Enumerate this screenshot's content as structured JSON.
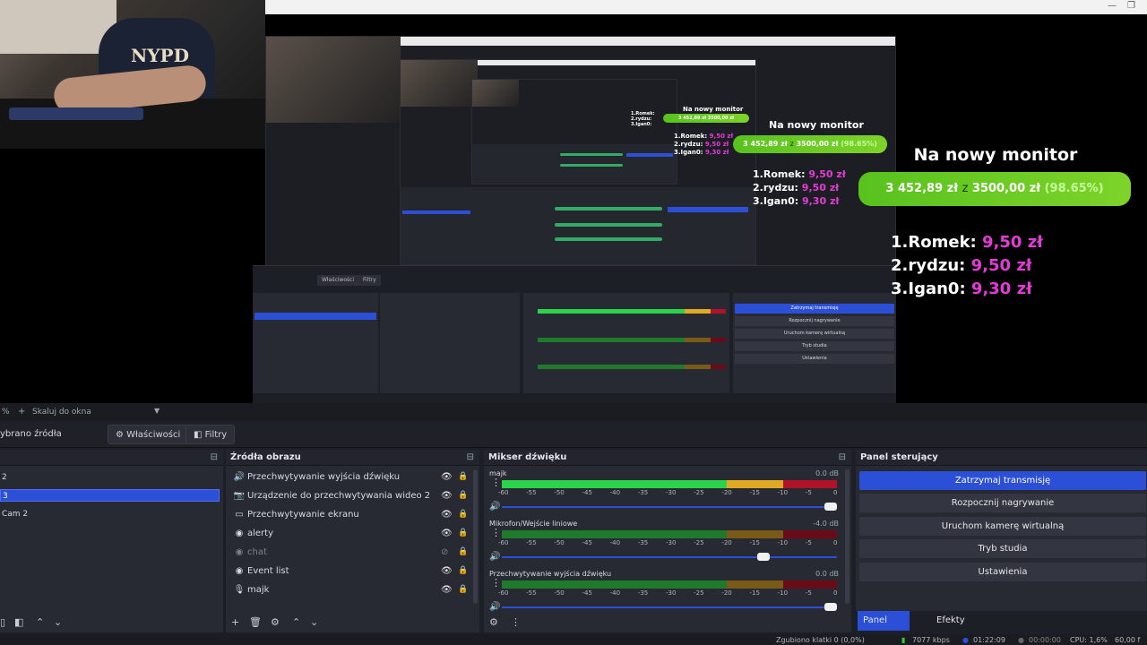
{
  "preview": {
    "goal_title": "Na nowy monitor",
    "goal_amount": "3 452,89 zł",
    "goal_sep": "z",
    "goal_target": "3500,00 zł",
    "goal_percent": "(98.65%)",
    "goal_progress": 0.9865,
    "shirt_text": "NYPD",
    "donors": [
      {
        "rank": "1.",
        "name": "Romek:",
        "amount": "9,50 zł"
      },
      {
        "rank": "2.",
        "name": "rydzu:",
        "amount": "9,50 zł"
      },
      {
        "rank": "3.",
        "name": "Igan0:",
        "amount": "9,30 zł"
      }
    ],
    "nested_tabs": {
      "properties": "Właściwości",
      "filters": "Filtry"
    },
    "nested_controls": [
      "Zatrzymaj transmisję",
      "Rozpocznij nagrywanie",
      "Uruchom kamerę wirtualną",
      "Tryb studia",
      "Ustawienia"
    ]
  },
  "strip": {
    "zoom": "%",
    "scale_label": "Skaluj do okna"
  },
  "props_bar": {
    "selected": "ybrano źródła",
    "properties": "Właściwości",
    "filters": "Filtry"
  },
  "scenes": {
    "items": [
      {
        "label": "2",
        "selected": false
      },
      {
        "label": "3",
        "selected": true
      },
      {
        "label": "Cam 2",
        "selected": false
      }
    ]
  },
  "sources": {
    "title": "Źródła obrazu",
    "items": [
      {
        "icon": "speaker-icon",
        "label": "Przechwytywanie wyjścia dźwięku",
        "visible": true
      },
      {
        "icon": "camera-icon",
        "label": "Urządzenie do przechwytywania wideo 2",
        "visible": true
      },
      {
        "icon": "monitor-icon",
        "label": "Przechwytywanie ekranu",
        "visible": true
      },
      {
        "icon": "globe-icon",
        "label": "alerty",
        "visible": true
      },
      {
        "icon": "globe-icon",
        "label": "chat",
        "visible": false
      },
      {
        "icon": "globe-icon",
        "label": "Event list",
        "visible": true
      },
      {
        "icon": "microphone-icon",
        "label": "majk",
        "visible": true
      }
    ]
  },
  "mixer": {
    "title": "Mikser dźwięku",
    "ticks": [
      "-60",
      "-55",
      "-50",
      "-45",
      "-40",
      "-35",
      "-30",
      "-25",
      "-20",
      "-15",
      "-10",
      "-5",
      "0"
    ],
    "channels": [
      {
        "name": "majk",
        "db": "0.0 dB",
        "level": 0.97,
        "volume": 1.0
      },
      {
        "name": "Mikrofon/Wejście liniowe",
        "db": "-4.0 dB",
        "level": 0.0,
        "volume": 0.8
      },
      {
        "name": "Przechwytywanie wyjścia dźwięku",
        "db": "0.0 dB",
        "level": 0.0,
        "volume": 1.0
      }
    ]
  },
  "controls": {
    "title": "Panel sterujący",
    "buttons": [
      {
        "label": "Zatrzymaj transmisję",
        "active": true
      },
      {
        "label": "Rozpocznij nagrywanie",
        "active": false
      },
      {
        "label": "Uruchom kamerę wirtualną",
        "active": false
      },
      {
        "label": "Tryb studia",
        "active": false
      },
      {
        "label": "Ustawienia",
        "active": false
      }
    ],
    "tabs": [
      {
        "label": "Panel sterujący",
        "active": true
      },
      {
        "label": "Efekty przejścia scen",
        "active": false
      }
    ]
  },
  "status": {
    "dropped": "Zgubiono klatki 0 (0,0%)",
    "bitrate": "7077 kbps",
    "stream_time": "01:22:09",
    "rec_time": "00:00:00",
    "cpu": "CPU: 1,6%",
    "fps": "60,00 f"
  },
  "colors": {
    "accent": "#2b4fd6",
    "goal_green": "#6fcd23",
    "donor_pink": "#e43bd7"
  }
}
